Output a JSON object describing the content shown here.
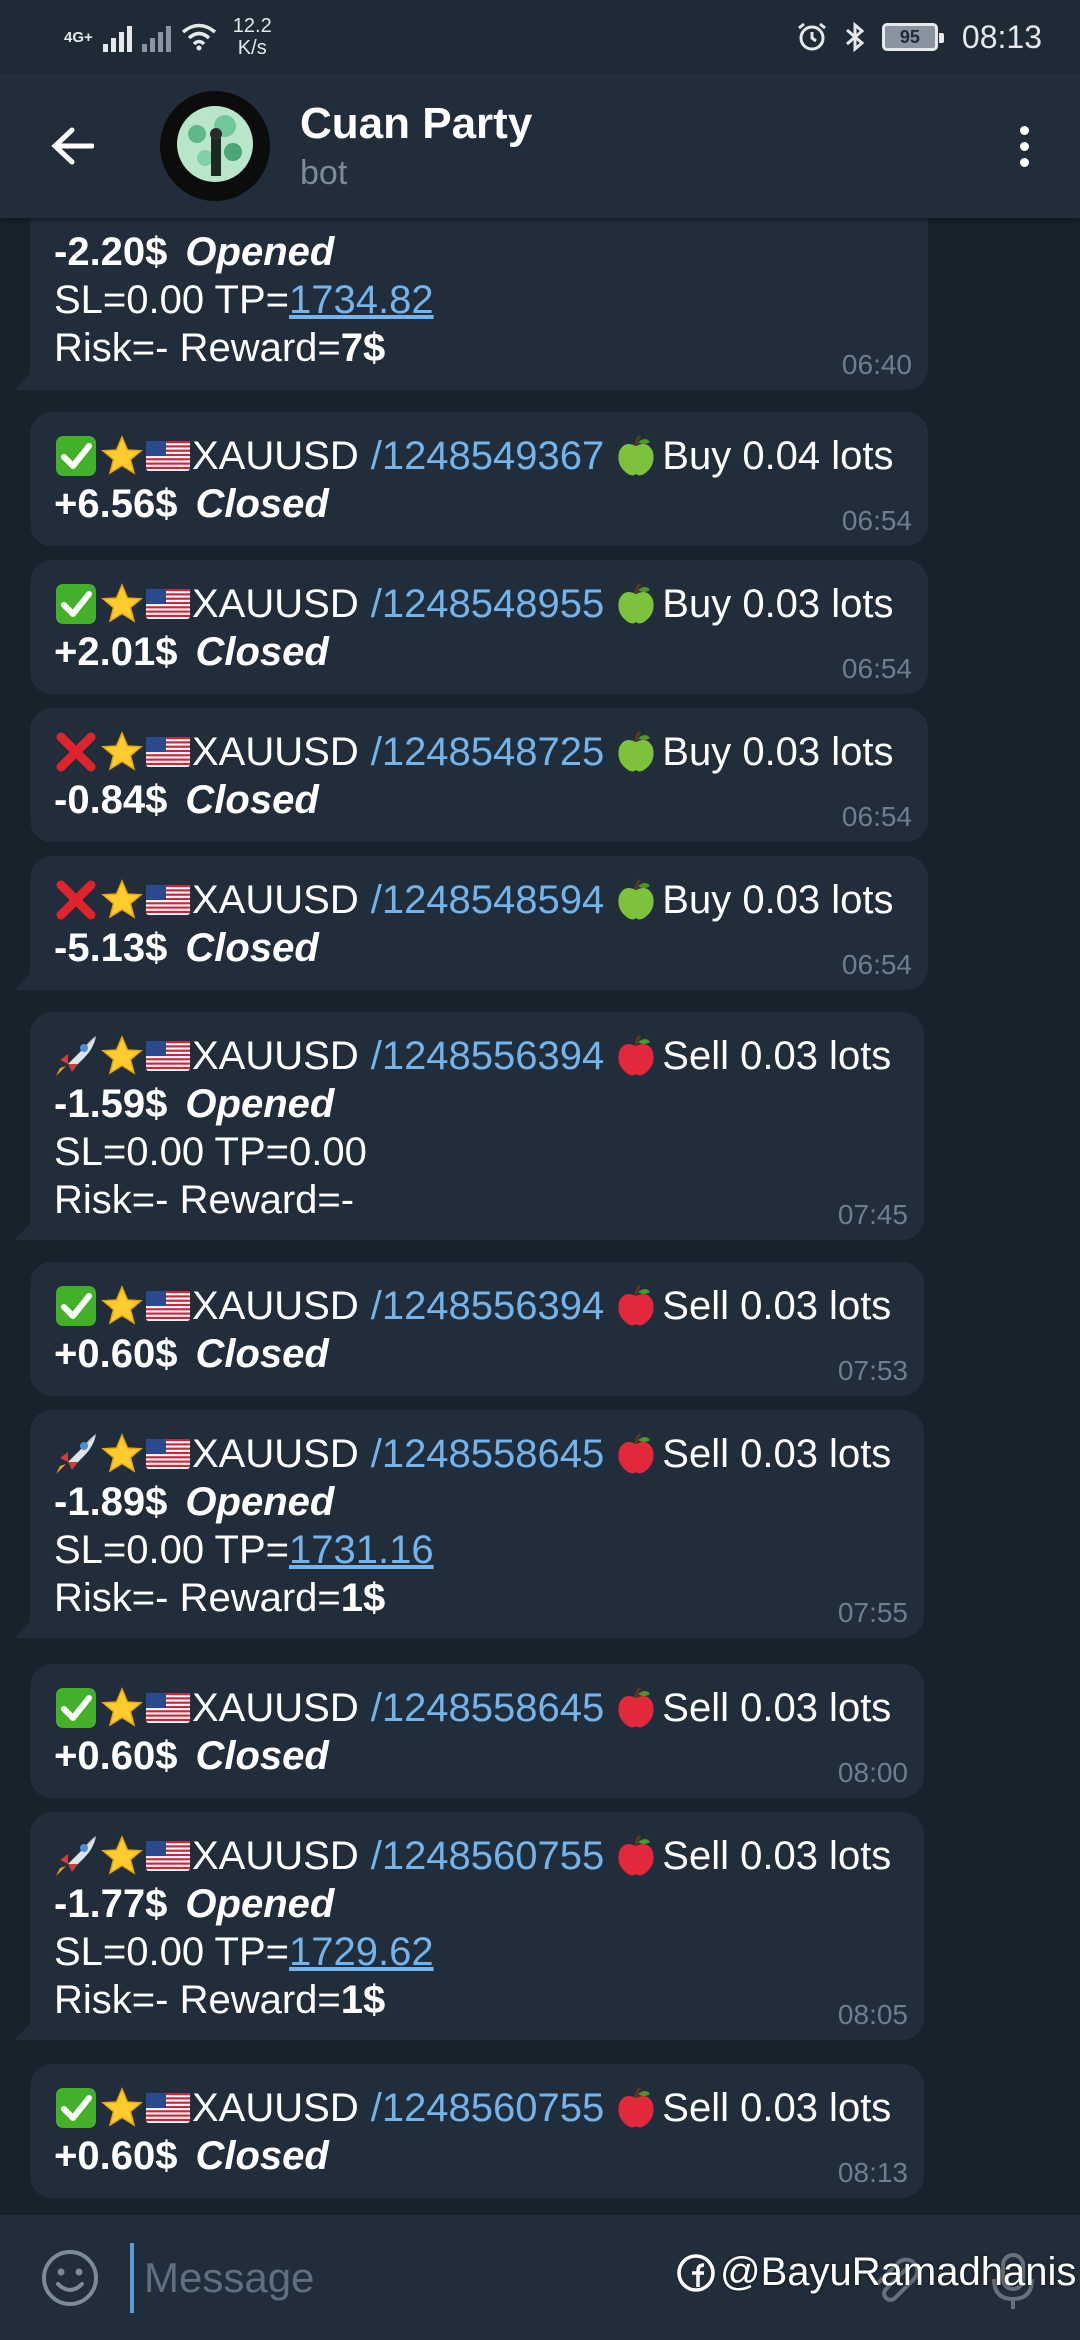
{
  "status_bar": {
    "network": "4G+",
    "speed": "12.2",
    "speed_unit": "K/s",
    "battery": "95",
    "time": "08:13"
  },
  "header": {
    "title": "Cuan Party",
    "subtitle": "bot",
    "back_icon": "arrow-left-icon",
    "menu_icon": "more-vertical-icon"
  },
  "partial_top_message": {
    "pnl": "-2.20$",
    "state": "Opened",
    "sl_text": "SL=0.00 TP=",
    "tp": "1734.82",
    "risk_text": "Risk=- Reward=",
    "reward": "7$",
    "time": "06:40"
  },
  "messages": [
    {
      "status_icon": "check",
      "symbol": "XAUUSD",
      "ticket": "/1248549367",
      "side_icon": "green-apple",
      "side": "Buy 0.04 lots",
      "pnl": "+6.56$",
      "state": "Closed",
      "time": "06:54"
    },
    {
      "status_icon": "check",
      "symbol": "XAUUSD",
      "ticket": "/1248548955",
      "side_icon": "green-apple",
      "side": "Buy 0.03 lots",
      "pnl": "+2.01$",
      "state": "Closed",
      "time": "06:54"
    },
    {
      "status_icon": "cross",
      "symbol": "XAUUSD",
      "ticket": "/1248548725",
      "side_icon": "green-apple",
      "side": "Buy 0.03 lots",
      "pnl": "-0.84$",
      "state": "Closed",
      "time": "06:54"
    },
    {
      "status_icon": "cross",
      "symbol": "XAUUSD",
      "ticket": "/1248548594",
      "side_icon": "green-apple",
      "side": "Buy 0.03 lots",
      "pnl": "-5.13$",
      "state": "Closed",
      "time": "06:54"
    },
    {
      "status_icon": "rocket",
      "symbol": "XAUUSD",
      "ticket": "/1248556394",
      "side_icon": "red-apple",
      "side": "Sell 0.03 lots",
      "pnl": "-1.59$",
      "state": "Opened",
      "sl_text": "SL=0.00 TP=0.00",
      "risk_text": "Risk=- Reward=-",
      "time": "07:45"
    },
    {
      "status_icon": "check",
      "symbol": "XAUUSD",
      "ticket": "/1248556394",
      "side_icon": "red-apple",
      "side": "Sell 0.03 lots",
      "pnl": "+0.60$",
      "state": "Closed",
      "time": "07:53"
    },
    {
      "status_icon": "rocket",
      "symbol": "XAUUSD",
      "ticket": "/1248558645",
      "side_icon": "red-apple",
      "side": "Sell 0.03 lots",
      "pnl": "-1.89$",
      "state": "Opened",
      "sl_text": "SL=0.00 TP=",
      "tp": "1731.16",
      "risk_text": "Risk=- Reward=",
      "reward": "1$",
      "time": "07:55"
    },
    {
      "status_icon": "check",
      "symbol": "XAUUSD",
      "ticket": "/1248558645",
      "side_icon": "red-apple",
      "side": "Sell 0.03 lots",
      "pnl": "+0.60$",
      "state": "Closed",
      "time": "08:00"
    },
    {
      "status_icon": "rocket",
      "symbol": "XAUUSD",
      "ticket": "/1248560755",
      "side_icon": "red-apple",
      "side": "Sell 0.03 lots",
      "pnl": "-1.77$",
      "state": "Opened",
      "sl_text": "SL=0.00 TP=",
      "tp": "1729.62",
      "risk_text": "Risk=- Reward=",
      "reward": "1$",
      "time": "08:05"
    },
    {
      "status_icon": "check",
      "symbol": "XAUUSD",
      "ticket": "/1248560755",
      "side_icon": "red-apple",
      "side": "Sell 0.03 lots",
      "pnl": "+0.60$",
      "state": "Closed",
      "time": "08:13"
    }
  ],
  "input": {
    "placeholder": "Message",
    "emoji_icon": "smiley-icon",
    "attach_icon": "paperclip-icon",
    "mic_icon": "microphone-icon"
  },
  "watermark": "@BayuRamadhanis",
  "colors": {
    "background": "#18222d",
    "bubble": "#212d3b",
    "header": "#212d3b",
    "link": "#73b4ec",
    "time": "#6d7e8f"
  }
}
